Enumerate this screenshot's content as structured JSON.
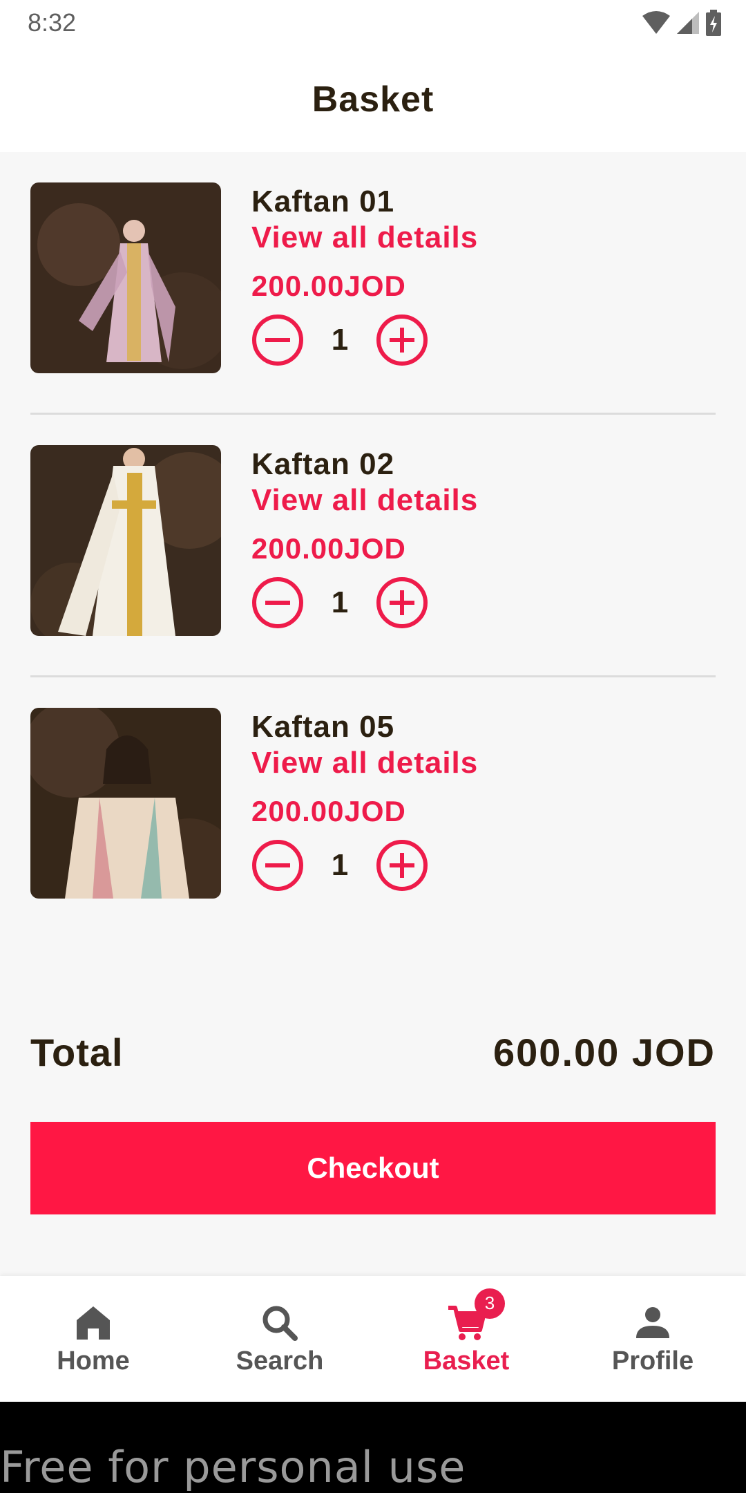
{
  "status_bar": {
    "time": "8:32"
  },
  "header": {
    "title": "Basket"
  },
  "items": [
    {
      "name": "Kaftan 01",
      "details_link": "View all details",
      "price": "200.00JOD",
      "quantity": "1"
    },
    {
      "name": "Kaftan 02",
      "details_link": "View all details",
      "price": "200.00JOD",
      "quantity": "1"
    },
    {
      "name": "Kaftan 05",
      "details_link": "View all details",
      "price": "200.00JOD",
      "quantity": "1"
    }
  ],
  "summary": {
    "total_label": "Total",
    "total_value": "600.00 JOD"
  },
  "checkout_label": "Checkout",
  "bottom_nav": {
    "items": [
      {
        "label": "Home",
        "icon": "home-icon"
      },
      {
        "label": "Search",
        "icon": "search-icon"
      },
      {
        "label": "Basket",
        "icon": "cart-icon",
        "badge": "3",
        "active": true
      },
      {
        "label": "Profile",
        "icon": "person-icon"
      }
    ]
  },
  "watermark": "Free for personal use",
  "colors": {
    "accent": "#ee1b4a",
    "button": "#ff1744",
    "text": "#2b2010",
    "background": "#f7f7f7"
  }
}
